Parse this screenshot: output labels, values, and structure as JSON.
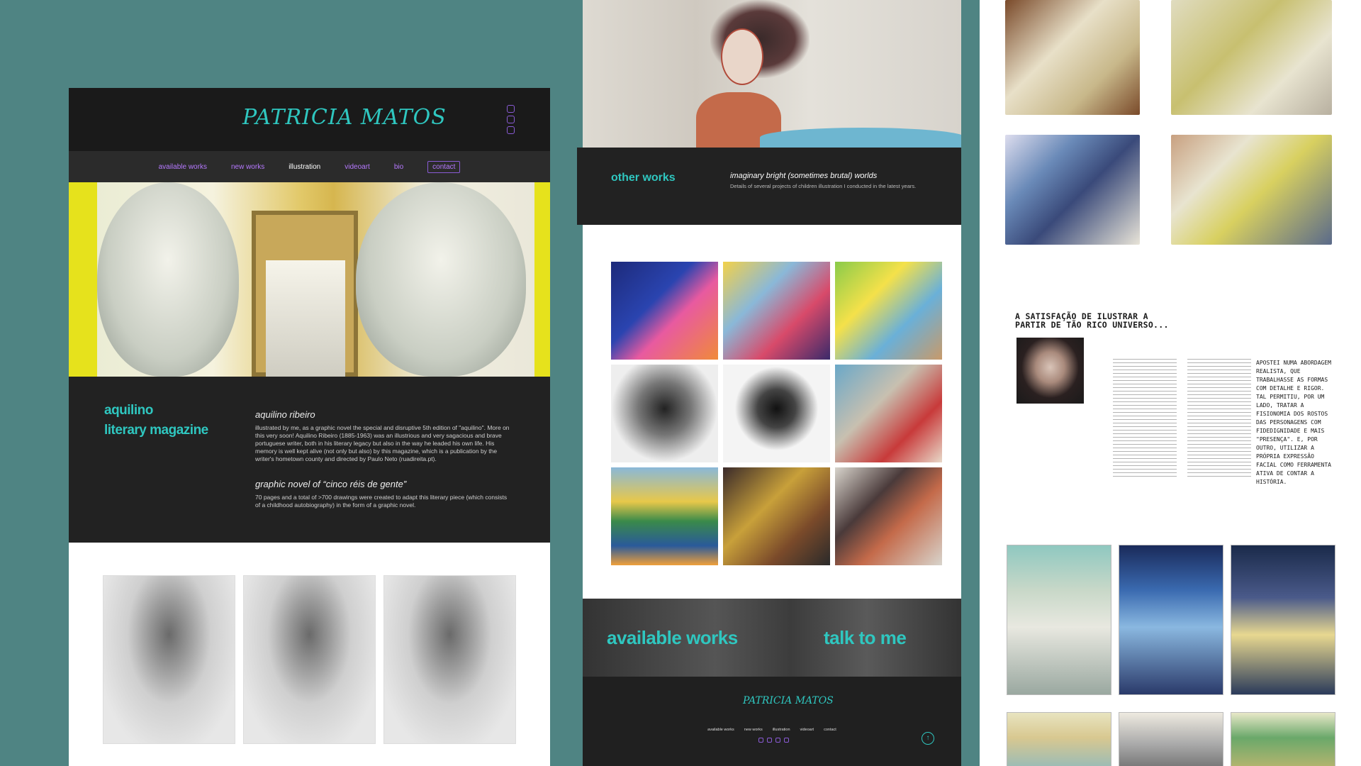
{
  "site": {
    "logo": "PATRICIA MATOS",
    "nav": [
      "available works",
      "new works",
      "illustration",
      "videoart",
      "bio",
      "contact"
    ],
    "nav_active": "illustration",
    "social_icons": [
      "instagram-icon",
      "facebook-icon",
      "mail-icon"
    ]
  },
  "feature": {
    "side_title_line1": "aquilino",
    "side_title_line2": "literary magazine",
    "section1_title": "aquilino ribeiro",
    "section1_text": "illustrated by me, as a graphic novel the special and disruptive 5th edition of \"aquilino\". More on this very soon! Aquilino Ribeiro (1885-1963) was an illustrious and very sagacious and brave portuguese writer, both in his literary legacy but also in the way he leaded his own life. His memory is well kept alive (not only but also) by this magazine, which is a publication by the writer's hometown county and directed by Paulo Neto (ruadireita.pt).",
    "section2_title": "graphic novel of “cinco réis de gente”",
    "section2_text": "70 pages and a total of >700 drawings were created to adapt this literary piece (which consists of a childhood autobiography) in the form of a graphic novel."
  },
  "other_works": {
    "title": "other works",
    "tagline": "imaginary bright (sometimes brutal) worlds",
    "description": "Details of several projects of children illustration I conducted in the latest years."
  },
  "cta": {
    "left": "available works",
    "right": "talk to me"
  },
  "footer": {
    "logo": "PATRICIA MATOS",
    "nav": [
      "available works",
      "new works",
      "illustration",
      "videoart",
      "contact"
    ]
  },
  "article": {
    "title": "A SATISFAÇÃO DE ILUSTRAR A PARTIR DE TÃO RICO UNIVERSO...",
    "quote": "APOSTEI NUMA ABORDAGEM REALISTA, QUE TRABALHASSE AS FORMAS COM DETALHE E RIGOR. TAL PERMITIU, POR UM LADO, TRATAR A FISIONOMIA DOS ROSTOS DAS PERSONAGENS COM FIDEDIGNIDADE E MAIS \"PRESENÇA\". E, POR OUTRO, UTILIZAR A PRÓPRIA EXPRESSÃO FACIAL COMO FERRAMENTA ATIVA DE CONTAR A HISTÓRIA."
  },
  "colors": {
    "background": "#4f8483",
    "accent_cyan": "#2fc7c0",
    "accent_purple": "#b679ff",
    "dark": "#222222"
  }
}
